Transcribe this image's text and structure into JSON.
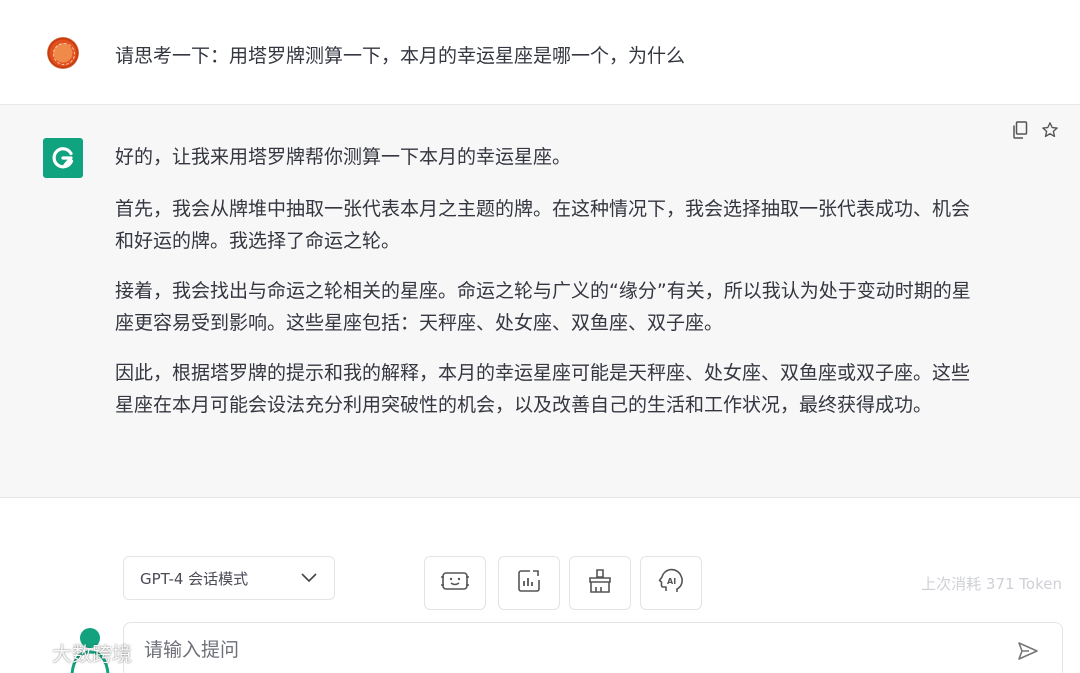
{
  "user_message": {
    "text": "请思考一下：用塔罗牌测算一下，本月的幸运星座是哪一个，为什么"
  },
  "assistant_message": {
    "paragraphs": [
      "好的，让我来用塔罗牌帮你测算一下本月的幸运星座。",
      "首先，我会从牌堆中抽取一张代表本月之主题的牌。在这种情况下，我会选择抽取一张代表成功、机会和好运的牌。我选择了命运之轮。",
      "接着，我会找出与命运之轮相关的星座。命运之轮与广义的“缘分”有关，所以我认为处于变动时期的星座更容易受到影响。这些星座包括：天秤座、处女座、双鱼座、双子座。",
      "因此，根据塔罗牌的提示和我的解释，本月的幸运星座可能是天秤座、处女座、双鱼座或双子座。这些星座在本月可能会设法充分利用突破性的机会，以及改善自己的生活和工作状况，最终获得成功。"
    ],
    "actions": [
      "copy-icon",
      "star-icon"
    ]
  },
  "composer": {
    "model_select_value": "GPT-4 会话模式",
    "tools": [
      "face-scan-icon",
      "chart-icon",
      "broom-icon",
      "ai-head-icon"
    ],
    "token_info": "上次消耗 371 Token",
    "input_placeholder": "请输入提问"
  },
  "watermark": {
    "text": "大数跨境"
  },
  "colors": {
    "brand_green": "#10a37f",
    "assistant_bg": "#f7f7f8",
    "text": "#353740"
  }
}
